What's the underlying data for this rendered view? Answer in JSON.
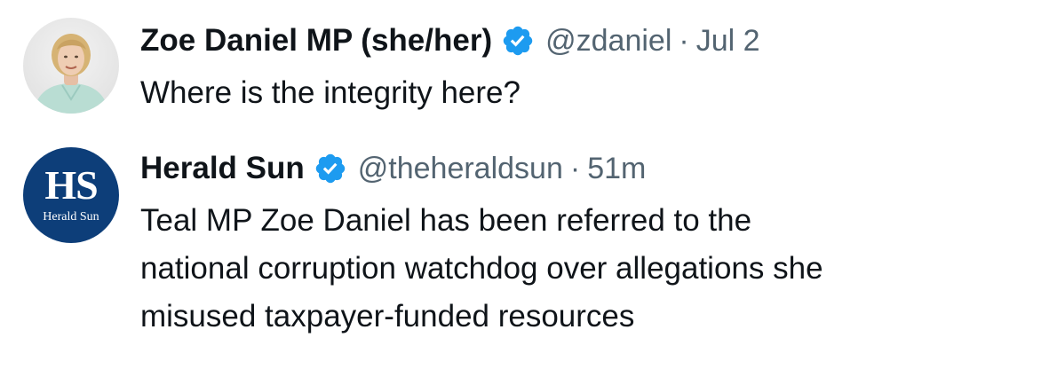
{
  "tweets": [
    {
      "author": {
        "display_name": "Zoe Daniel MP (she/her)",
        "handle": "@zdaniel",
        "verified": true,
        "avatar_icon": "profile-photo"
      },
      "separator": "·",
      "timestamp": "Jul 2",
      "text": "Where is the integrity here?"
    },
    {
      "author": {
        "display_name": "Herald Sun",
        "handle": "@theheraldsun",
        "verified": true,
        "avatar_icon": "herald-sun-logo",
        "avatar_logo_text": "HS",
        "avatar_logo_subtext": "Herald Sun"
      },
      "separator": "·",
      "timestamp": "51m",
      "text_lines": [
        "Teal MP Zoe Daniel has been referred to the",
        "national corruption watchdog over allegations she",
        "misused taxpayer-funded resources"
      ]
    }
  ],
  "colors": {
    "text_primary": "#0f1419",
    "text_secondary": "#536471",
    "verified_badge": "#1d9bf0",
    "herald_sun_brand": "#0d3e79"
  }
}
